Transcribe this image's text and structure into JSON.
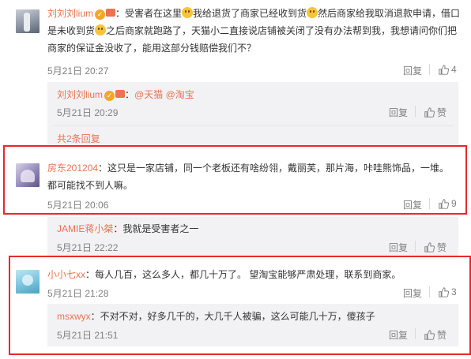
{
  "comments": [
    {
      "user": "刘刘刘lium",
      "text_parts": [
        "：受害者在这里",
        "我给退货了商家已经收到货",
        "然后商家给我取消退款申请，借口是未收到货",
        "之后商家就跑路了，天猫小二直接说店铺被关闭了没有办法帮到我，我想请问你们把商家的保证金没收了，能用这部分钱赔偿我们不？"
      ],
      "time": "5月21日 20:27",
      "reply": "回复",
      "likes": "4"
    },
    {
      "user": "房东201204",
      "text": "：这只是一家店铺，同一个老板还有啥纷翎，戴丽芙，那片海，咔哇熊饰品，一堆。都可能找不到人嘛。",
      "time": "5月21日 20:06",
      "reply": "回复",
      "likes": "9"
    },
    {
      "user": "小小七xx",
      "text": "：每人几百，这么多人，都几十万了。 望淘宝能够严肃处理，联系到商家。",
      "time": "5月21日 21:28",
      "reply": "回复",
      "likes": "3"
    }
  ],
  "sub_replies": [
    {
      "user": "刘刘刘lium",
      "text_prefix": "：",
      "mentions": [
        "@天猫",
        "@淘宝"
      ],
      "time": "5月21日 20:29",
      "reply": "回复",
      "like_label": "赞"
    },
    {
      "user": "JAMIE蒋小桀",
      "text": "：我就是受害者之一",
      "time": "5月21日 22:22",
      "reply": "回复",
      "like_label": "赞"
    },
    {
      "user": "msxwyx",
      "text": "：不对不对，好多几千的，大几千人被骗，这么可能几十万，傻孩子",
      "time": "5月21日 21:51",
      "reply": "回复",
      "like_label": "赞"
    }
  ],
  "more_replies": "共2条回复",
  "colors": {
    "accent": "#eb7350",
    "highlight_box": "#e8282b",
    "subbox_bg": "#f2f2f5"
  },
  "icons": {
    "like": "thumbs-up-icon",
    "verified": "verified-badge-icon",
    "emoji": "emoji-face-icon"
  }
}
